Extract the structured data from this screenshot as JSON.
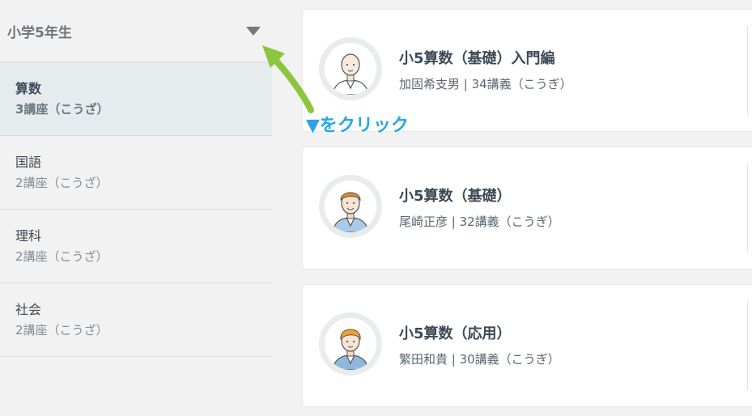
{
  "sidebar": {
    "grade_label": "小学5年生",
    "subjects": [
      {
        "name": "算数",
        "count": "3講座（こうざ）",
        "active": true
      },
      {
        "name": "国語",
        "count": "2講座（こうざ）"
      },
      {
        "name": "理科",
        "count": "2講座（こうざ）"
      },
      {
        "name": "社会",
        "count": "2講座（こうざ）"
      }
    ]
  },
  "courses": [
    {
      "title": "小5算数（基礎）入門編",
      "teacher": "加固希支男",
      "lectures": "34講義（こうぎ）",
      "meta": "加固希支男 | 34講義（こうぎ）"
    },
    {
      "title": "小5算数（基礎）",
      "teacher": "尾崎正彦",
      "lectures": "32講義（こうぎ）",
      "meta": "尾崎正彦 | 32講義（こうぎ）"
    },
    {
      "title": "小5算数（応用）",
      "teacher": "繁田和貴",
      "lectures": "30講義（こうぎ）",
      "meta": "繁田和貴 | 30講義（こうぎ）"
    }
  ],
  "annotation": {
    "text": "▼をクリック"
  },
  "colors": {
    "accent_annotation": "#29a5e6",
    "arrow": "#8cc63f",
    "active_bg": "#e6ebee"
  }
}
